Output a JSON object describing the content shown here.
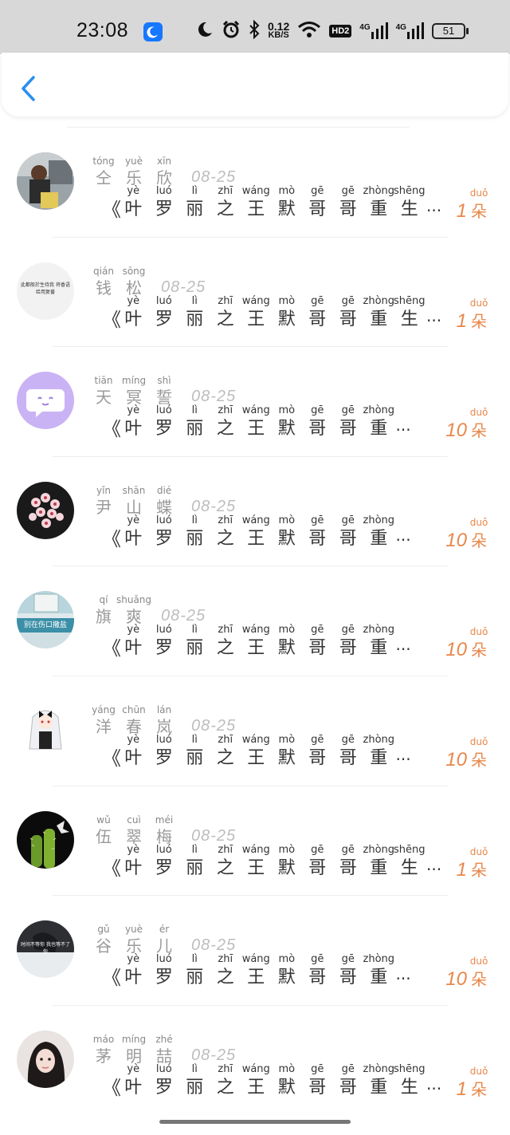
{
  "status_bar": {
    "time": "23:08",
    "net_speed_value": "0.12",
    "net_speed_unit": "KB/S",
    "hd_label": "HD2",
    "signal_1": "4G",
    "signal_2": "4G",
    "battery": "51",
    "icons": [
      "moon-app-icon",
      "moon-icon",
      "alarm-icon",
      "bluetooth-icon",
      "wifi-icon",
      "hd-icon",
      "signal-icon",
      "battery-icon"
    ]
  },
  "header": {
    "back_icon": "chevron-left-icon"
  },
  "accent_color": "#e8874a",
  "rows": [
    {
      "name": [
        [
          "tóng",
          "仝"
        ],
        [
          "yuè",
          "乐"
        ],
        [
          "xīn",
          "欣"
        ]
      ],
      "date": "08-25",
      "message": [
        [
          "yè",
          "叶"
        ],
        [
          "luó",
          "罗"
        ],
        [
          "lì",
          "丽"
        ],
        [
          "zhī",
          "之"
        ],
        [
          "wáng",
          "王"
        ],
        [
          "mò",
          "默"
        ],
        [
          "gē",
          "哥"
        ],
        [
          "gē",
          "哥"
        ],
        [
          "zhòng",
          "重"
        ],
        [
          "shēng",
          "生"
        ]
      ],
      "flower_count": "1",
      "flower_unit": [
        "duǒ",
        "朵"
      ]
    },
    {
      "name": [
        [
          "qián",
          "钱"
        ],
        [
          "sōng",
          "松"
        ]
      ],
      "date": "08-25",
      "message": [
        [
          "yè",
          "叶"
        ],
        [
          "luó",
          "罗"
        ],
        [
          "lì",
          "丽"
        ],
        [
          "zhī",
          "之"
        ],
        [
          "wáng",
          "王"
        ],
        [
          "mò",
          "默"
        ],
        [
          "gē",
          "哥"
        ],
        [
          "gē",
          "哥"
        ],
        [
          "zhòng",
          "重"
        ],
        [
          "shēng",
          "生"
        ]
      ],
      "flower_count": "1",
      "flower_unit": [
        "duǒ",
        "朵"
      ]
    },
    {
      "name": [
        [
          "tiān",
          "天"
        ],
        [
          "míng",
          "冥"
        ],
        [
          "shì",
          "誓"
        ]
      ],
      "date": "08-25",
      "message": [
        [
          "yè",
          "叶"
        ],
        [
          "luó",
          "罗"
        ],
        [
          "lì",
          "丽"
        ],
        [
          "zhī",
          "之"
        ],
        [
          "wáng",
          "王"
        ],
        [
          "mò",
          "默"
        ],
        [
          "gē",
          "哥"
        ],
        [
          "gē",
          "哥"
        ],
        [
          "zhòng",
          "重"
        ]
      ],
      "flower_count": "10",
      "flower_unit": [
        "duǒ",
        "朵"
      ]
    },
    {
      "name": [
        [
          "yǐn",
          "尹"
        ],
        [
          "shān",
          "山"
        ],
        [
          "dié",
          "蝶"
        ]
      ],
      "date": "08-25",
      "message": [
        [
          "yè",
          "叶"
        ],
        [
          "luó",
          "罗"
        ],
        [
          "lì",
          "丽"
        ],
        [
          "zhī",
          "之"
        ],
        [
          "wáng",
          "王"
        ],
        [
          "mò",
          "默"
        ],
        [
          "gē",
          "哥"
        ],
        [
          "gē",
          "哥"
        ],
        [
          "zhòng",
          "重"
        ]
      ],
      "flower_count": "10",
      "flower_unit": [
        "duǒ",
        "朵"
      ]
    },
    {
      "name": [
        [
          "qí",
          "旗"
        ],
        [
          "shuǎng",
          "爽"
        ]
      ],
      "date": "08-25",
      "message": [
        [
          "yè",
          "叶"
        ],
        [
          "luó",
          "罗"
        ],
        [
          "lì",
          "丽"
        ],
        [
          "zhī",
          "之"
        ],
        [
          "wáng",
          "王"
        ],
        [
          "mò",
          "默"
        ],
        [
          "gē",
          "哥"
        ],
        [
          "gē",
          "哥"
        ],
        [
          "zhòng",
          "重"
        ]
      ],
      "flower_count": "10",
      "flower_unit": [
        "duǒ",
        "朵"
      ]
    },
    {
      "name": [
        [
          "yáng",
          "洋"
        ],
        [
          "chūn",
          "春"
        ],
        [
          "lán",
          "岚"
        ]
      ],
      "date": "08-25",
      "message": [
        [
          "yè",
          "叶"
        ],
        [
          "luó",
          "罗"
        ],
        [
          "lì",
          "丽"
        ],
        [
          "zhī",
          "之"
        ],
        [
          "wáng",
          "王"
        ],
        [
          "mò",
          "默"
        ],
        [
          "gē",
          "哥"
        ],
        [
          "gē",
          "哥"
        ],
        [
          "zhòng",
          "重"
        ]
      ],
      "flower_count": "10",
      "flower_unit": [
        "duǒ",
        "朵"
      ]
    },
    {
      "name": [
        [
          "wǔ",
          "伍"
        ],
        [
          "cuì",
          "翠"
        ],
        [
          "méi",
          "梅"
        ]
      ],
      "date": "08-25",
      "message": [
        [
          "yè",
          "叶"
        ],
        [
          "luó",
          "罗"
        ],
        [
          "lì",
          "丽"
        ],
        [
          "zhī",
          "之"
        ],
        [
          "wáng",
          "王"
        ],
        [
          "mò",
          "默"
        ],
        [
          "gē",
          "哥"
        ],
        [
          "gē",
          "哥"
        ],
        [
          "zhòng",
          "重"
        ],
        [
          "shēng",
          "生"
        ]
      ],
      "flower_count": "1",
      "flower_unit": [
        "duǒ",
        "朵"
      ]
    },
    {
      "name": [
        [
          "gǔ",
          "谷"
        ],
        [
          "yuè",
          "乐"
        ],
        [
          "ér",
          "儿"
        ]
      ],
      "date": "08-25",
      "message": [
        [
          "yè",
          "叶"
        ],
        [
          "luó",
          "罗"
        ],
        [
          "lì",
          "丽"
        ],
        [
          "zhī",
          "之"
        ],
        [
          "wáng",
          "王"
        ],
        [
          "mò",
          "默"
        ],
        [
          "gē",
          "哥"
        ],
        [
          "gē",
          "哥"
        ],
        [
          "zhòng",
          "重"
        ]
      ],
      "flower_count": "10",
      "flower_unit": [
        "duǒ",
        "朵"
      ]
    },
    {
      "name": [
        [
          "máo",
          "茅"
        ],
        [
          "míng",
          "明"
        ],
        [
          "zhé",
          "喆"
        ]
      ],
      "date": "08-25",
      "message": [
        [
          "yè",
          "叶"
        ],
        [
          "luó",
          "罗"
        ],
        [
          "lì",
          "丽"
        ],
        [
          "zhī",
          "之"
        ],
        [
          "wáng",
          "王"
        ],
        [
          "mò",
          "默"
        ],
        [
          "gē",
          "哥"
        ],
        [
          "gē",
          "哥"
        ],
        [
          "zhòng",
          "重"
        ],
        [
          "shēng",
          "生"
        ]
      ],
      "flower_count": "1",
      "flower_unit": [
        "duǒ",
        "朵"
      ]
    }
  ],
  "avatars": [
    {
      "icon": "person-photo-avatar",
      "text": ""
    },
    {
      "icon": "text-avatar",
      "text": "此都般於生待我 将香语给用复番"
    },
    {
      "icon": "chat-bubble-avatar",
      "text": ""
    },
    {
      "icon": "flower-photo-avatar",
      "text": ""
    },
    {
      "icon": "street-sign-avatar",
      "text": "别在伤口撒盐"
    },
    {
      "icon": "anime-girl-avatar",
      "text": ""
    },
    {
      "icon": "cactus-photo-avatar",
      "text": ""
    },
    {
      "icon": "hand-photo-avatar",
      "text": "时间不等你 我也等不了你"
    },
    {
      "icon": "girl-photo-avatar",
      "text": ""
    }
  ],
  "quote_mark": "《",
  "ellipsis": "···"
}
